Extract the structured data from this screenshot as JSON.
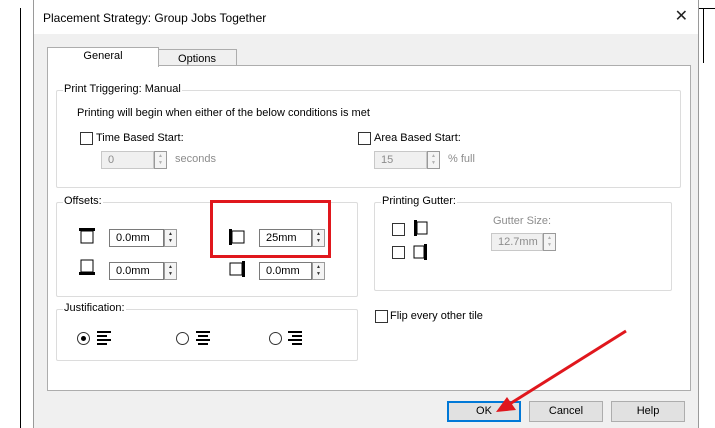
{
  "dialog": {
    "title": "Placement Strategy: Group Jobs Together"
  },
  "tabs": [
    {
      "label": "General"
    },
    {
      "label": "Options"
    }
  ],
  "print_triggering": {
    "title": "Print Triggering: Manual",
    "description": "Printing will begin when either of the below conditions is met",
    "time_based": {
      "label": "Time Based Start:",
      "checked": false,
      "value": "0",
      "unit": "seconds"
    },
    "area_based": {
      "label": "Area Based Start:",
      "checked": false,
      "value": "15",
      "unit": "% full"
    }
  },
  "offsets": {
    "title": "Offsets:",
    "top": "0.0mm",
    "left": "25mm",
    "bottom": "0.0mm",
    "right": "0.0mm"
  },
  "printing_gutter": {
    "title": "Printing Gutter:",
    "gutter_size_label": "Gutter Size:",
    "gutter_size_value": "12.7mm"
  },
  "justification": {
    "title": "Justification:",
    "selected": "left"
  },
  "flip_every_other_tile": {
    "label": "Flip every other tile",
    "checked": false
  },
  "buttons": {
    "ok": "OK",
    "cancel": "Cancel",
    "help": "Help"
  },
  "annotation_color": "#e0171d"
}
